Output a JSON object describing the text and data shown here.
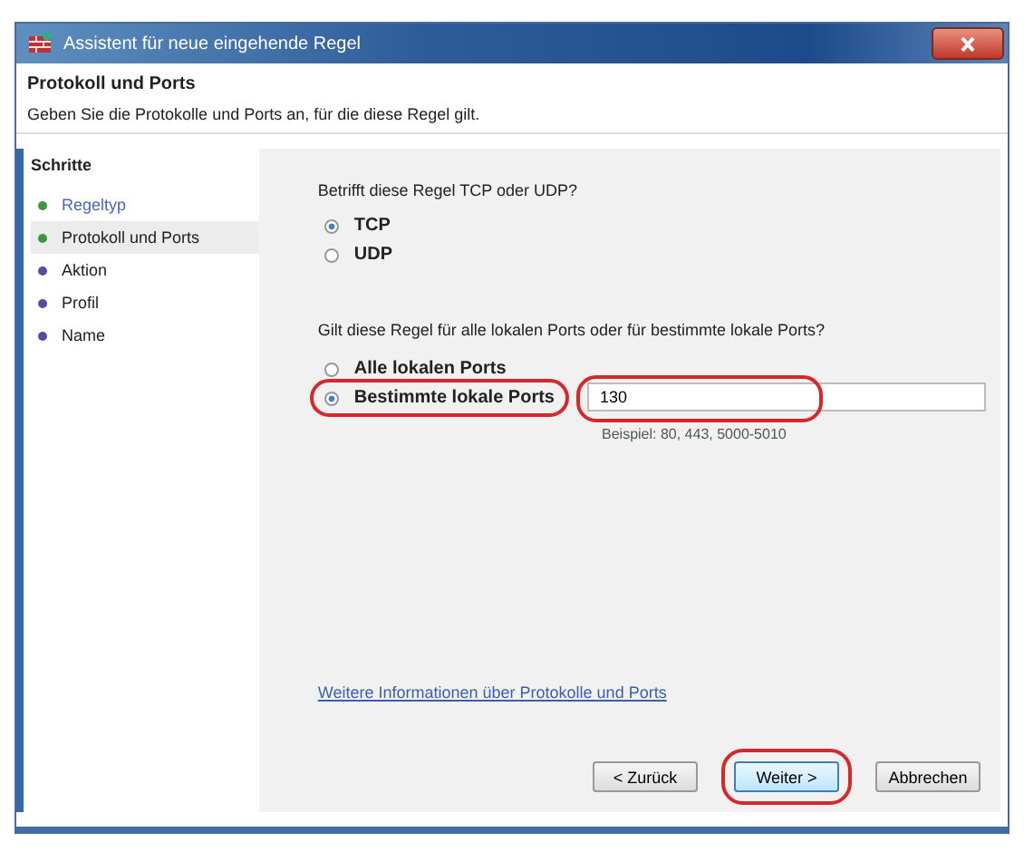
{
  "window": {
    "title": "Assistent für neue eingehende Regel"
  },
  "header": {
    "title": "Protokoll und Ports",
    "subtitle": "Geben Sie die Protokolle und Ports an, für die diese Regel gilt."
  },
  "sidebar": {
    "title": "Schritte",
    "items": [
      {
        "label": "Regeltyp",
        "done": true,
        "selected": false
      },
      {
        "label": "Protokoll und Ports",
        "done": true,
        "selected": true
      },
      {
        "label": "Aktion",
        "done": false,
        "selected": false
      },
      {
        "label": "Profil",
        "done": false,
        "selected": false
      },
      {
        "label": "Name",
        "done": false,
        "selected": false
      }
    ]
  },
  "protocol": {
    "question": "Betrifft diese Regel TCP oder UDP?",
    "options": [
      {
        "label": "TCP",
        "selected": true
      },
      {
        "label": "UDP",
        "selected": false
      }
    ]
  },
  "ports": {
    "question": "Gilt diese Regel für alle lokalen Ports oder für bestimmte lokale Ports?",
    "options": [
      {
        "label": "Alle lokalen Ports",
        "selected": false,
        "highlighted": false
      },
      {
        "label": "Bestimmte lokale Ports",
        "selected": true,
        "highlighted": true
      }
    ],
    "field": {
      "value": "130",
      "highlighted": true
    },
    "example": "Beispiel: 80, 443, 5000-5010"
  },
  "link": "Weitere Informationen über Protokolle und Ports",
  "buttons": [
    {
      "label": "< Zurück",
      "highlighted": false,
      "default": false
    },
    {
      "label": "Weiter >",
      "highlighted": true,
      "default": true
    },
    {
      "label": "Abbrechen",
      "highlighted": false,
      "default": false
    }
  ]
}
